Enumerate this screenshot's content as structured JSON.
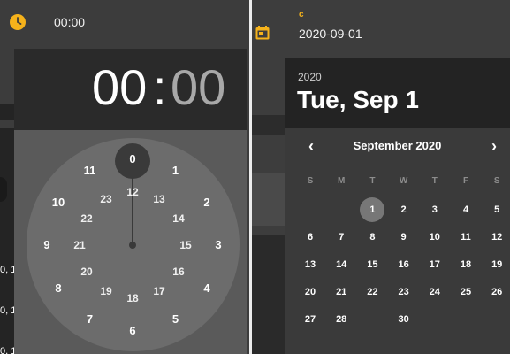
{
  "left": {
    "time_value": "00:00",
    "picker": {
      "hours": "00",
      "separator": ":",
      "minutes": "00",
      "outer_numbers": [
        "0",
        "1",
        "2",
        "3",
        "4",
        "5",
        "6",
        "7",
        "8",
        "9",
        "10",
        "11"
      ],
      "inner_numbers": [
        "12",
        "13",
        "14",
        "15",
        "16",
        "17",
        "18",
        "19",
        "20",
        "21",
        "22",
        "23"
      ],
      "selected": "0"
    },
    "edge_text": [
      "0, 1",
      "0, 1",
      "0, 1"
    ]
  },
  "right": {
    "field_label": "c",
    "date_value": "2020-09-01",
    "picker": {
      "year": "2020",
      "date_heading": "Tue, Sep 1",
      "month_title": "September 2020",
      "prev_icon": "‹",
      "next_icon": "›",
      "weekdays": [
        "S",
        "M",
        "T",
        "W",
        "T",
        "F",
        "S"
      ],
      "weeks": [
        [
          "",
          "",
          "1",
          "2",
          "3",
          "4",
          "5"
        ],
        [
          "6",
          "7",
          "8",
          "9",
          "10",
          "11",
          "12"
        ],
        [
          "13",
          "14",
          "15",
          "16",
          "17",
          "18",
          "19"
        ],
        [
          "20",
          "21",
          "22",
          "23",
          "24",
          "25",
          "26"
        ],
        [
          "27",
          "28",
          "",
          "30",
          "",
          "",
          ""
        ]
      ],
      "selected_day": "1"
    }
  },
  "colors": {
    "accent": "#f5b21b",
    "dial": "#6c6c6c",
    "header": "#2a2a2a",
    "selected": "#777777"
  }
}
